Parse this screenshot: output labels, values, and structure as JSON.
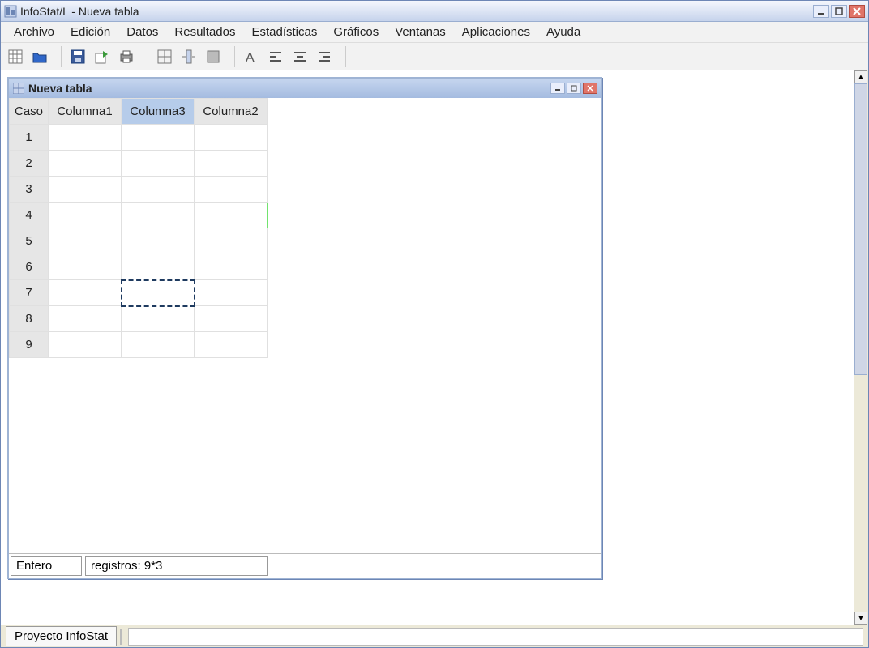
{
  "window": {
    "title": "InfoStat/L - Nueva tabla"
  },
  "menu": {
    "items": [
      "Archivo",
      "Edición",
      "Datos",
      "Resultados",
      "Estadísticas",
      "Gráficos",
      "Ventanas",
      "Aplicaciones",
      "Ayuda"
    ]
  },
  "child": {
    "title": "Nueva tabla",
    "columns": [
      "Caso",
      "Columna1",
      "Columna3",
      "Columna2"
    ],
    "selected_column_index": 2,
    "selected_row_index": 6,
    "rows": [
      {
        "caso": "1",
        "cells": [
          "",
          "",
          ""
        ],
        "styles": [
          "pink",
          "",
          ""
        ]
      },
      {
        "caso": "2",
        "cells": [
          "",
          "",
          ""
        ],
        "styles": [
          "",
          "",
          ""
        ]
      },
      {
        "caso": "3",
        "cells": [
          "",
          "",
          ""
        ],
        "styles": [
          "",
          "",
          ""
        ]
      },
      {
        "caso": "4",
        "cells": [
          "",
          "",
          ""
        ],
        "styles": [
          "",
          "",
          "green"
        ]
      },
      {
        "caso": "5",
        "cells": [
          "",
          "",
          ""
        ],
        "styles": [
          "",
          "",
          ""
        ]
      },
      {
        "caso": "6",
        "cells": [
          "",
          "",
          ""
        ],
        "styles": [
          "",
          "",
          ""
        ]
      },
      {
        "caso": "7",
        "cells": [
          "",
          "",
          ""
        ],
        "styles": [
          "",
          "bluecell",
          ""
        ]
      },
      {
        "caso": "8",
        "cells": [
          "",
          "",
          ""
        ],
        "styles": [
          "",
          "",
          ""
        ]
      },
      {
        "caso": "9",
        "cells": [
          "",
          "",
          ""
        ],
        "styles": [
          "",
          "",
          ""
        ]
      }
    ],
    "status": {
      "type": "Entero",
      "records": "registros: 9*3"
    }
  },
  "statusbar": {
    "project_tab": "Proyecto InfoStat"
  }
}
